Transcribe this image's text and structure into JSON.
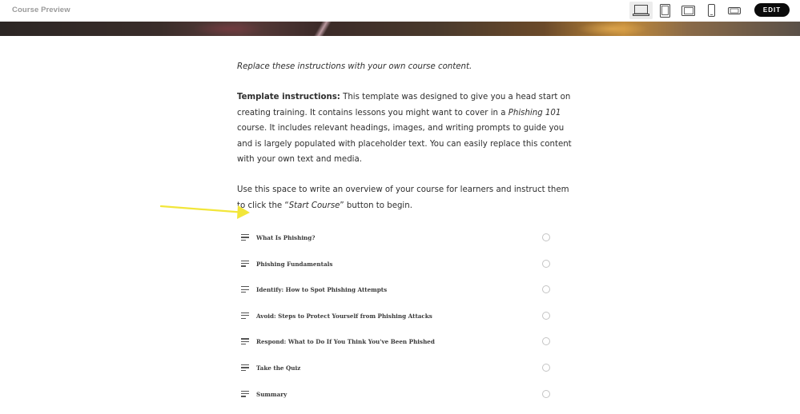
{
  "header": {
    "title": "Course Preview",
    "edit_label": "EDIT",
    "devices": [
      {
        "name": "desktop-icon",
        "active": true
      },
      {
        "name": "tablet-portrait-icon",
        "active": false
      },
      {
        "name": "tablet-landscape-icon",
        "active": false
      },
      {
        "name": "phone-portrait-icon",
        "active": false
      },
      {
        "name": "phone-landscape-icon",
        "active": false
      }
    ]
  },
  "content": {
    "intro": "Replace these instructions with your own course content.",
    "instructions_label": "Template instructions:",
    "instructions_part1": " This template was designed to give you a head start on creating training. It contains lessons you might want to cover in a ",
    "course_name": "Phishing 101",
    "instructions_part2": " course. It includes relevant headings, images, and writing prompts to guide you and is largely populated with placeholder text. You can easily replace this content with your own text and media.",
    "overview_part1": "Use this space to write an overview of your course for learners and instruct them to click the “",
    "start_course": "Start Course",
    "overview_part2": "” button to begin."
  },
  "lessons": [
    {
      "title": "What Is Phishing?"
    },
    {
      "title": "Phishing Fundamentals"
    },
    {
      "title": "Identify: How to Spot Phishing Attempts"
    },
    {
      "title": "Avoid: Steps to Protect Yourself from Phishing Attacks"
    },
    {
      "title": "Respond: What to Do If You Think You've Been Phished"
    },
    {
      "title": "Take the Quiz"
    },
    {
      "title": "Summary"
    }
  ],
  "colors": {
    "arrow": "#f2e63a",
    "edit_button_bg": "#0b0b0b"
  }
}
